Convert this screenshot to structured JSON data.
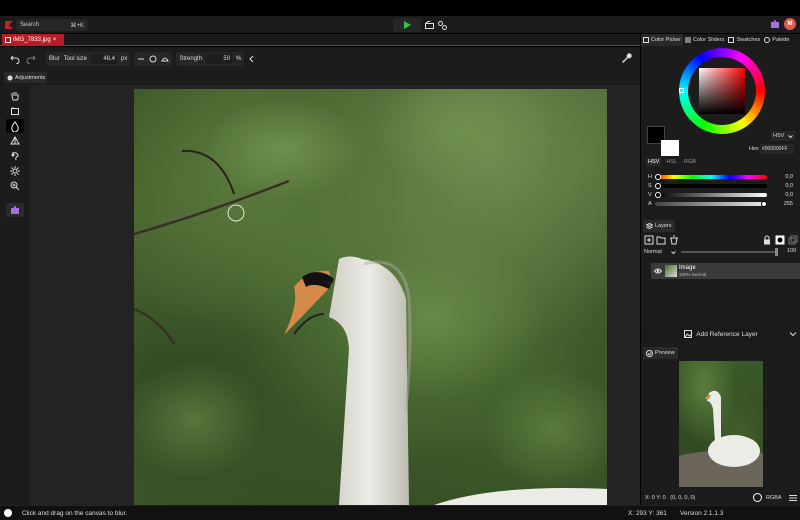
{
  "topbar": {
    "search_label": "Search",
    "search_shortcut": "⌘+K",
    "avatar_letter": "M"
  },
  "document": {
    "tab_label": "IMG_7833.jpg",
    "tab_close": "×"
  },
  "options": {
    "tool_name": "Blur",
    "tool_size_label": "Tool size",
    "tool_size_value": "48,4",
    "tool_size_unit": "px",
    "strength_label": "Strength",
    "strength_value": "50",
    "strength_unit": "%"
  },
  "adjustments": {
    "label": "Adjustments"
  },
  "tools": [
    "hand-icon",
    "crop-icon",
    "blur-icon",
    "sharpen-icon",
    "smudge-icon",
    "brightness-icon",
    "zoom-icon",
    "plugin-icon"
  ],
  "color_picker": {
    "tabs": [
      "Color Picker",
      "Color Sliders",
      "Swatches",
      "Palette"
    ],
    "color_mode": "HSV",
    "hex_label": "Hex",
    "hex_value": "#000000FF",
    "mode_tabs": [
      "HSV",
      "HSL",
      "RGB"
    ],
    "sliders": [
      {
        "label": "H",
        "value": "0,0"
      },
      {
        "label": "S",
        "value": "0,0"
      },
      {
        "label": "V",
        "value": "0,0"
      },
      {
        "label": "A",
        "value": "255"
      }
    ],
    "primary_color": "#000000",
    "secondary_color": "#ffffff"
  },
  "layers": {
    "tab_label": "Layers",
    "blend_mode": "Normal",
    "opacity": "100",
    "items": [
      {
        "name": "Image",
        "sub": "100% Normal"
      }
    ]
  },
  "reference": {
    "label": "Add Reference Layer"
  },
  "preview": {
    "tab_label": "Preview",
    "xy": "X: 0 Y: 0",
    "rgba_value": "(0, 0, 0, 0)",
    "mode": "RGBA"
  },
  "status": {
    "message": "Click and drag on the canvas to blur.",
    "coords": "X: 293 Y: 361",
    "version": "Version 2.1.1.3"
  },
  "colors": {
    "accent": "#c51f2b",
    "panel": "#1c1c1c",
    "play": "#3fbf3f"
  }
}
